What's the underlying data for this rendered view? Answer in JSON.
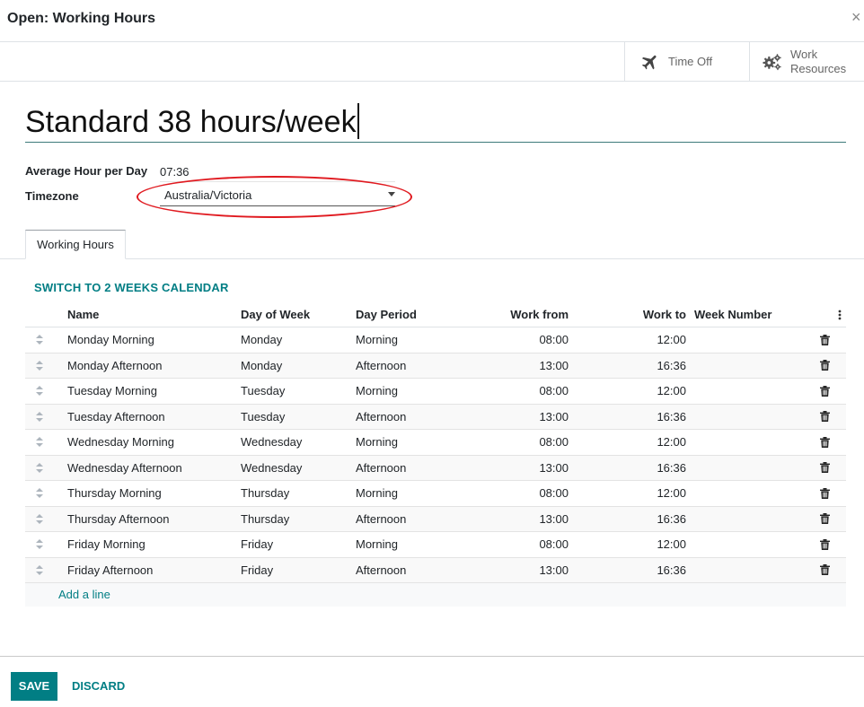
{
  "dialog": {
    "title": "Open: Working Hours",
    "close_glyph": "×"
  },
  "smart_buttons": [
    {
      "label": "Time Off",
      "icon": "plane-icon"
    },
    {
      "label_line1": "Work",
      "label_line2": "Resources",
      "icon": "gears-icon"
    }
  ],
  "record": {
    "name": "Standard 38 hours/week",
    "avg_hour_label": "Average Hour per Day",
    "avg_hour_value": "07:36",
    "timezone_label": "Timezone",
    "timezone_value": "Australia/Victoria"
  },
  "tabs": [
    {
      "label": "Working Hours",
      "active": true
    }
  ],
  "switch_link": "SWITCH TO 2 WEEKS CALENDAR",
  "table": {
    "columns": {
      "name": "Name",
      "day_of_week": "Day of Week",
      "day_period": "Day Period",
      "work_from": "Work from",
      "work_to": "Work to",
      "week_number": "Week Number"
    },
    "rows": [
      {
        "name": "Monday Morning",
        "dow": "Monday",
        "period": "Morning",
        "from": "08:00",
        "to": "12:00"
      },
      {
        "name": "Monday Afternoon",
        "dow": "Monday",
        "period": "Afternoon",
        "from": "13:00",
        "to": "16:36"
      },
      {
        "name": "Tuesday Morning",
        "dow": "Tuesday",
        "period": "Morning",
        "from": "08:00",
        "to": "12:00"
      },
      {
        "name": "Tuesday Afternoon",
        "dow": "Tuesday",
        "period": "Afternoon",
        "from": "13:00",
        "to": "16:36"
      },
      {
        "name": "Wednesday Morning",
        "dow": "Wednesday",
        "period": "Morning",
        "from": "08:00",
        "to": "12:00"
      },
      {
        "name": "Wednesday Afternoon",
        "dow": "Wednesday",
        "period": "Afternoon",
        "from": "13:00",
        "to": "16:36"
      },
      {
        "name": "Thursday Morning",
        "dow": "Thursday",
        "period": "Morning",
        "from": "08:00",
        "to": "12:00"
      },
      {
        "name": "Thursday Afternoon",
        "dow": "Thursday",
        "period": "Afternoon",
        "from": "13:00",
        "to": "16:36"
      },
      {
        "name": "Friday Morning",
        "dow": "Friday",
        "period": "Morning",
        "from": "08:00",
        "to": "12:00"
      },
      {
        "name": "Friday Afternoon",
        "dow": "Friday",
        "period": "Afternoon",
        "from": "13:00",
        "to": "16:36"
      }
    ],
    "add_line": "Add a line"
  },
  "footer": {
    "save": "SAVE",
    "discard": "DISCARD"
  },
  "colors": {
    "accent": "#017e84",
    "annotation": "#e0191f"
  }
}
